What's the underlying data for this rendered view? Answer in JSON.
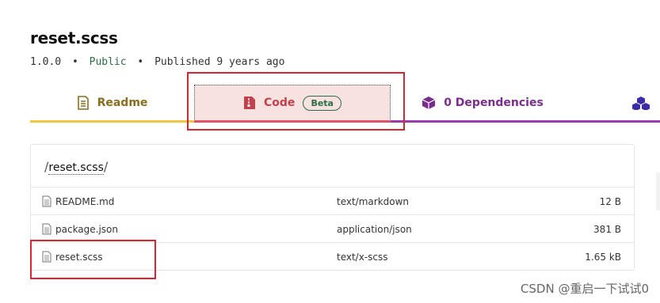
{
  "package": {
    "name": "reset.scss",
    "version": "1.0.0",
    "visibility": "Public",
    "published": "Published 9 years ago",
    "separator": "•"
  },
  "tabs": {
    "readme": {
      "label": "Readme",
      "icon": "readme-icon",
      "color": "#8a6d1d"
    },
    "code": {
      "label": "Code",
      "badge": "Beta",
      "icon": "file-code-icon",
      "color": "#c2414b"
    },
    "dependencies": {
      "label": "0 Dependencies",
      "icon": "box-icon",
      "color": "#7b2d8e"
    },
    "dependents": {
      "icon": "boxes-icon",
      "color": "#3b2da6"
    }
  },
  "browser": {
    "breadcrumb": {
      "root": "/",
      "segment": "reset.scss",
      "trail": "/"
    },
    "files": [
      {
        "name": "README.md",
        "type": "text/markdown",
        "size": "12 B"
      },
      {
        "name": "package.json",
        "type": "application/json",
        "size": "381 B"
      },
      {
        "name": "reset.scss",
        "type": "text/x-scss",
        "size": "1.65 kB"
      }
    ]
  },
  "watermark": "CSDN @重启一下试试0",
  "colors": {
    "highlight_border": "#d9252b",
    "readme_underline": "#f3c63f",
    "code_underline": "#e0516a",
    "deps_underline": "#9b3ab0"
  }
}
